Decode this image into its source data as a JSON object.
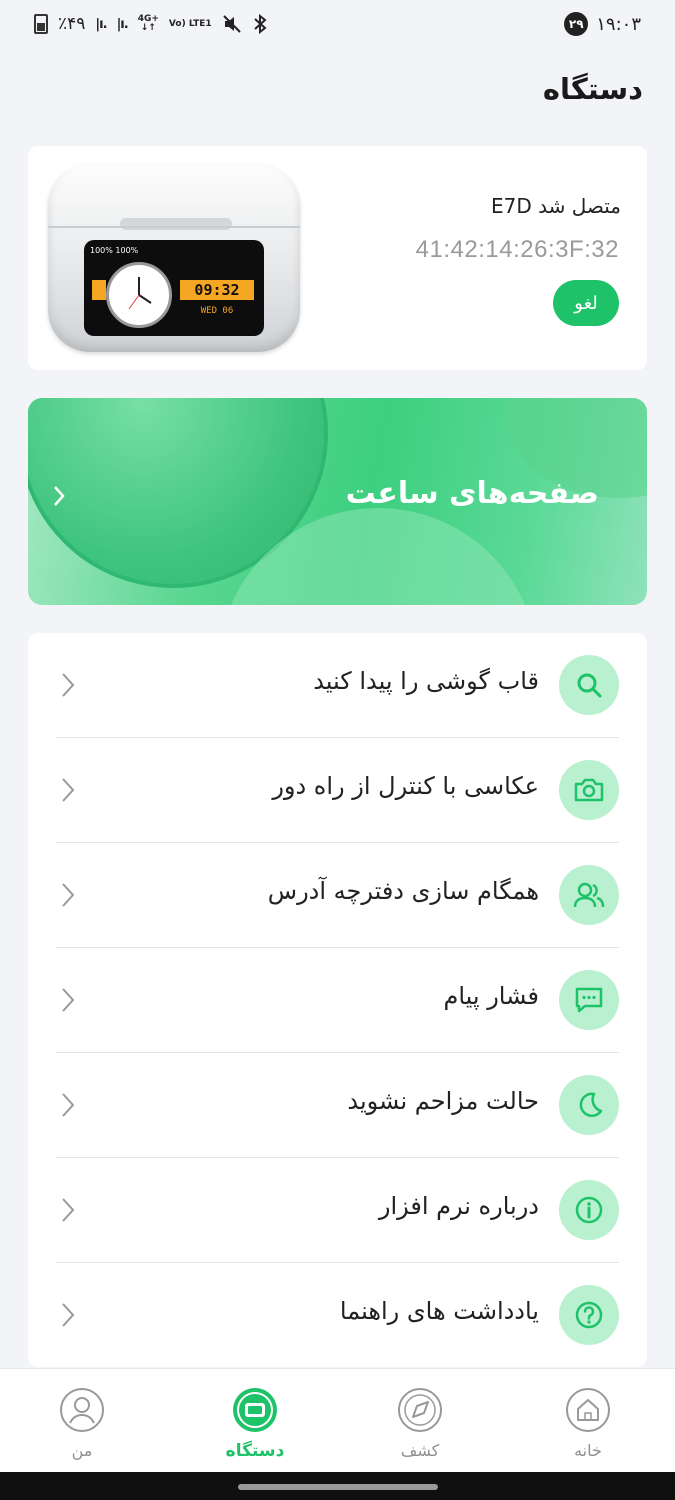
{
  "status_bar": {
    "battery": "٪۴۹",
    "network_1": "4G+",
    "network_2": "Vo) LTE1",
    "clock_badge": "۲۹",
    "time": "۱۹:۰۳"
  },
  "page_title": "دستگاه",
  "device": {
    "status_name": "متصل شد E7D",
    "mac": "41:42:14:26:3F:32",
    "cancel_label": "لغو",
    "screen_time": "09:32",
    "screen_date": "WED 06",
    "screen_status": "100% 100%"
  },
  "banner": {
    "title": "صفحه‌های ساعت"
  },
  "menu": {
    "items": [
      {
        "label": "قاب گوشی را پیدا کنید",
        "icon": "search-icon"
      },
      {
        "label": "عکاسی با کنترل از راه دور",
        "icon": "camera-icon"
      },
      {
        "label": "همگام سازی دفترچه آدرس",
        "icon": "contacts-icon"
      },
      {
        "label": "فشار پیام",
        "icon": "message-icon"
      },
      {
        "label": "حالت مزاحم نشوید",
        "icon": "moon-icon"
      },
      {
        "label": "درباره نرم افزار",
        "icon": "info-icon"
      },
      {
        "label": "یادداشت های راهنما",
        "icon": "help-icon"
      }
    ]
  },
  "nav": {
    "items": [
      {
        "label": "من",
        "icon": "profile-icon"
      },
      {
        "label": "دستگاه",
        "icon": "device-icon"
      },
      {
        "label": "کشف",
        "icon": "discover-icon"
      },
      {
        "label": "خانه",
        "icon": "home-icon"
      }
    ]
  },
  "colors": {
    "accent": "#1ec268",
    "icon_bg": "#b8f0d0",
    "background": "#f3f4f7"
  }
}
